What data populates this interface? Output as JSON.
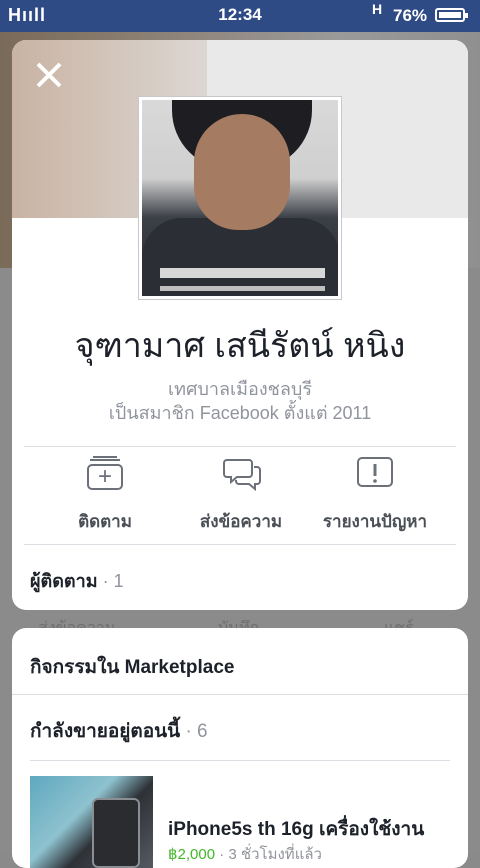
{
  "status_bar": {
    "network": "Hııll",
    "time": "12:34",
    "network_type": "H",
    "battery": "76%"
  },
  "background_tabs": [
    "ส่งข้อความ",
    "บันทึก",
    "แชร์"
  ],
  "profile": {
    "name": "จุฑามาศ เสนีรัตน์ หนิง",
    "location": "เทศบาลเมืองชลบุรี",
    "member_since": "เป็นสมาชิก Facebook ตั้งแต่ 2011",
    "actions": {
      "follow": "ติดตาม",
      "message": "ส่งข้อความ",
      "report": "รายงานปัญหา"
    },
    "followers_label": "ผู้ติดตาม",
    "followers_count": "· 1"
  },
  "marketplace": {
    "title": "กิจกรรมใน Marketplace",
    "selling_label": "กำลังขายอยู่ตอนนี้",
    "selling_count": "· 6",
    "item": {
      "title": "iPhone5s th 16g เครื่องใช้งาน",
      "price": "฿2,000",
      "time": " · 3 ชั่วโมงที่แล้ว"
    }
  },
  "colors": {
    "status_bar": "#2f4b86",
    "text_primary": "#1d2129",
    "text_secondary": "#90949c",
    "price_green": "#42b72a"
  },
  "icons": {
    "close": "close-icon",
    "follow": "follow-icon",
    "message": "message-icon",
    "report": "report-icon"
  }
}
